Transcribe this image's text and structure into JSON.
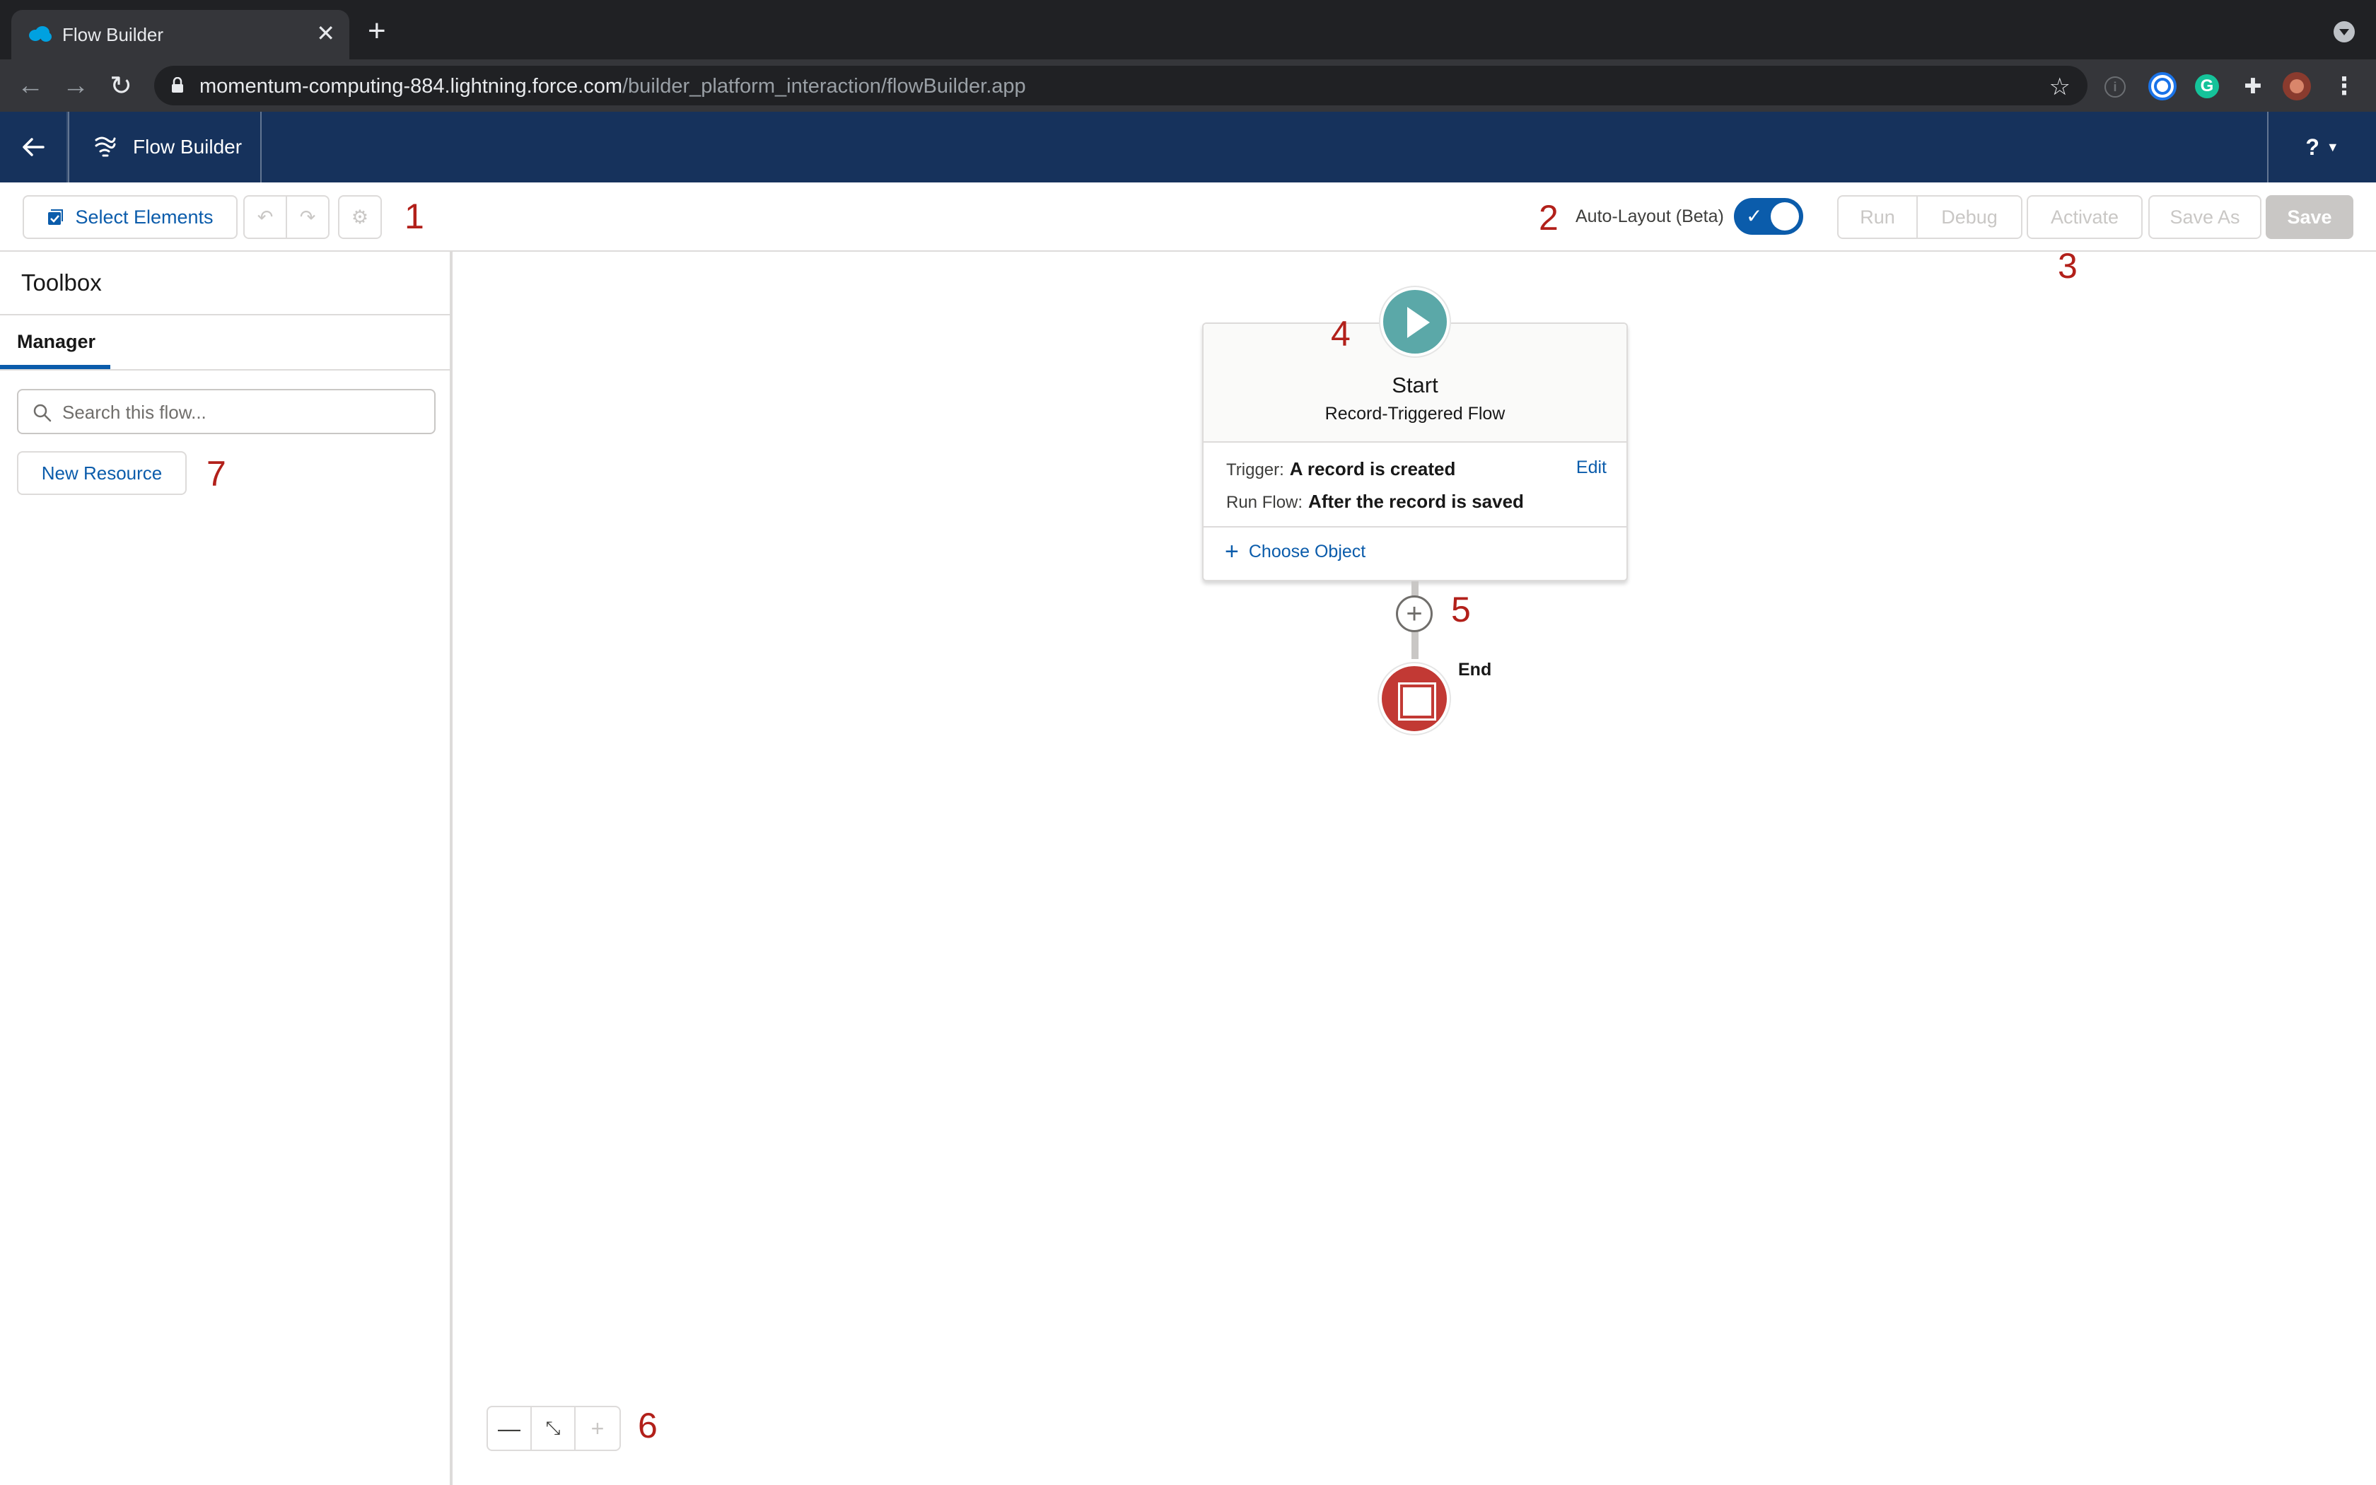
{
  "browser": {
    "tab_title": "Flow Builder",
    "tab_close": "✕",
    "new_tab": "+",
    "url_domain": "momentum-computing-884.lightning.force.com",
    "url_path": "/builder_platform_interaction/flowBuilder.app",
    "ext_info": "i",
    "ext_g": "G"
  },
  "header": {
    "app_name": "Flow Builder",
    "help": "?"
  },
  "toolbar": {
    "select_elements": "Select Elements",
    "auto_layout_label": "Auto-Layout (Beta)",
    "auto_layout_on": true,
    "run": "Run",
    "debug": "Debug",
    "activate": "Activate",
    "save_as": "Save As",
    "save": "Save"
  },
  "toolbox": {
    "title": "Toolbox",
    "tab": "Manager",
    "search_placeholder": "Search this flow...",
    "new_resource": "New Resource"
  },
  "start_node": {
    "title": "Start",
    "subtitle": "Record-Triggered Flow",
    "trigger_label": "Trigger:",
    "trigger_value": "A record is created",
    "run_flow_label": "Run Flow:",
    "run_flow_value": "After the record is saved",
    "edit": "Edit",
    "choose_object": "Choose Object"
  },
  "end_node": {
    "label": "End"
  },
  "annotations": [
    "1",
    "2",
    "3",
    "4",
    "5",
    "6",
    "7"
  ],
  "colors": {
    "header_bg": "#16325c",
    "brand_blue": "#0b5cab",
    "start_teal": "#5ba8a8",
    "end_red": "#c23934",
    "annotation_red": "#b2201a"
  }
}
